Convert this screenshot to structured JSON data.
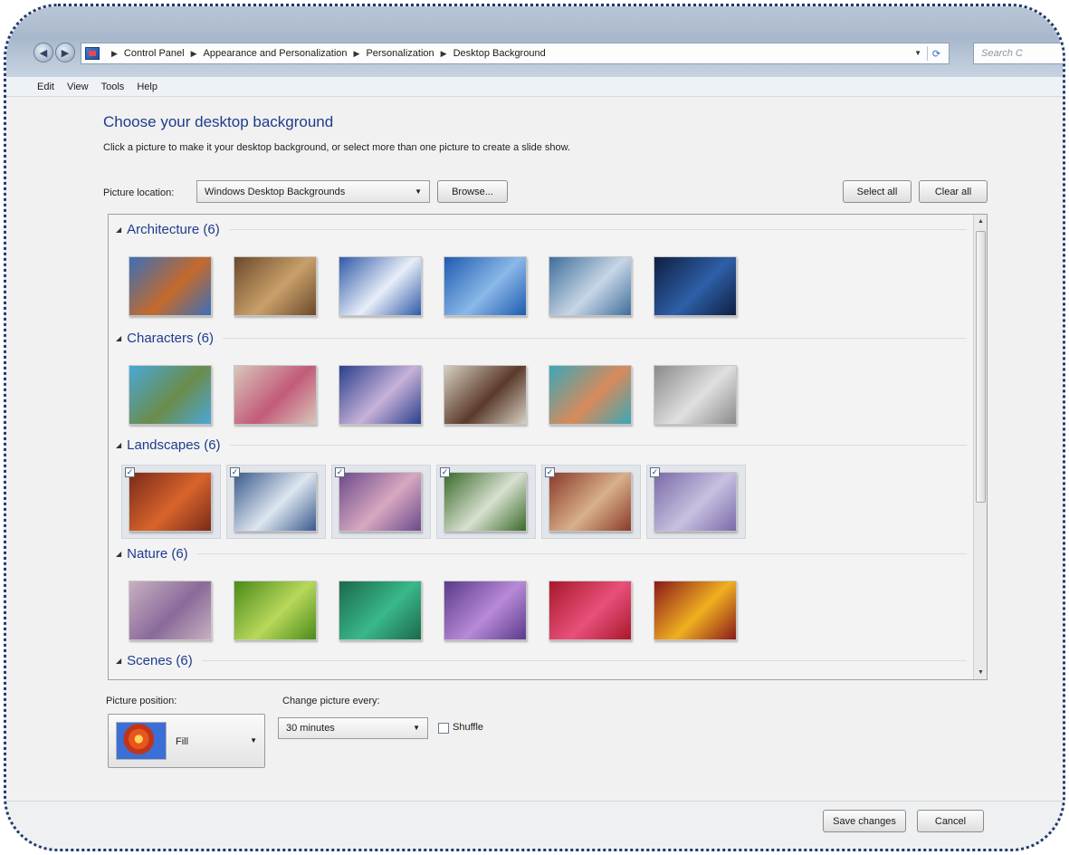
{
  "addressbar": {
    "breadcrumbs": [
      "Control Panel",
      "Appearance and Personalization",
      "Personalization",
      "Desktop Background"
    ],
    "search_placeholder": "Search C"
  },
  "menu": {
    "items": [
      "Edit",
      "View",
      "Tools",
      "Help"
    ]
  },
  "main": {
    "title": "Choose your desktop background",
    "subtitle": "Click a picture to make it your desktop background, or select more than one picture to create a slide show.",
    "picture_location_label": "Picture location:",
    "picture_location_value": "Windows Desktop Backgrounds",
    "browse_label": "Browse...",
    "select_all_label": "Select all",
    "clear_all_label": "Clear all"
  },
  "gallery": {
    "groups": [
      {
        "label": "Architecture (6)",
        "selected": false,
        "thumbs": [
          "#3b6fb8 #c46a2b",
          "#6b4a2b #c9a06a",
          "#2f5aa8 #e8eef8",
          "#1e5bb0 #8ab8e8",
          "#3e6e9c #c8d6e6",
          "#0e1f40 #2f5fa8"
        ]
      },
      {
        "label": "Characters (6)",
        "selected": false,
        "thumbs": [
          "#4aa8d8 #6b8c4a",
          "#d8c6b8 #c25b7a",
          "#2a3f8c #c8b2d8",
          "#d6d0c2 #5a3a2a",
          "#3aa8b8 #d88a5a",
          "#8a8a8a #e0e0e0"
        ]
      },
      {
        "label": "Landscapes (6)",
        "selected": true,
        "thumbs": [
          "#7a2a1a #d8642a",
          "#3a5a8c #dde6f0",
          "#6a4a8c #d8a8c0",
          "#3a6a2a #d8e0d0",
          "#8a3a2a #d8b08a",
          "#7a6aa8 #c8c0e0"
        ]
      },
      {
        "label": "Nature (6)",
        "selected": false,
        "thumbs": [
          "#c8b0c0 #8a6a9a",
          "#4a8a1a #b8d85a",
          "#1a6a4a #3ab88a",
          "#5a3a8a #b88ad8",
          "#a8182a #e8507a",
          "#8a1a1a #f0b020"
        ]
      },
      {
        "label": "Scenes (6)",
        "selected": false,
        "thumbs": []
      }
    ]
  },
  "bottom": {
    "picture_position_label": "Picture position:",
    "picture_position_value": "Fill",
    "change_every_label": "Change picture every:",
    "change_every_value": "30 minutes",
    "shuffle_label": "Shuffle",
    "shuffle_checked": false
  },
  "footer": {
    "save_label": "Save changes",
    "cancel_label": "Cancel"
  }
}
